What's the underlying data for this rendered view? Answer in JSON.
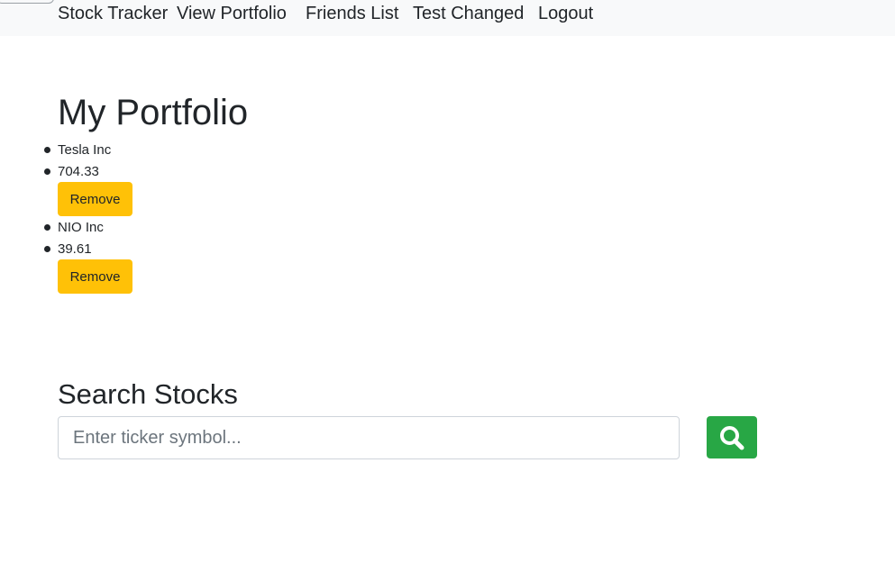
{
  "nav": {
    "brand": "Stock Tracker",
    "items": [
      "View Portfolio",
      "Friends List",
      "Test Changed",
      "Logout"
    ]
  },
  "portfolio": {
    "title": "My Portfolio",
    "stocks": [
      {
        "name": "Tesla Inc",
        "price": "704.33",
        "remove_label": "Remove"
      },
      {
        "name": "NIO Inc",
        "price": "39.61",
        "remove_label": "Remove"
      }
    ]
  },
  "search": {
    "title": "Search Stocks",
    "placeholder": "Enter ticker symbol...",
    "value": "",
    "button_icon": "search-icon"
  },
  "colors": {
    "navbar_bg": "#f8f9fa",
    "remove_button": "#ffc107",
    "search_button": "#28a745"
  }
}
